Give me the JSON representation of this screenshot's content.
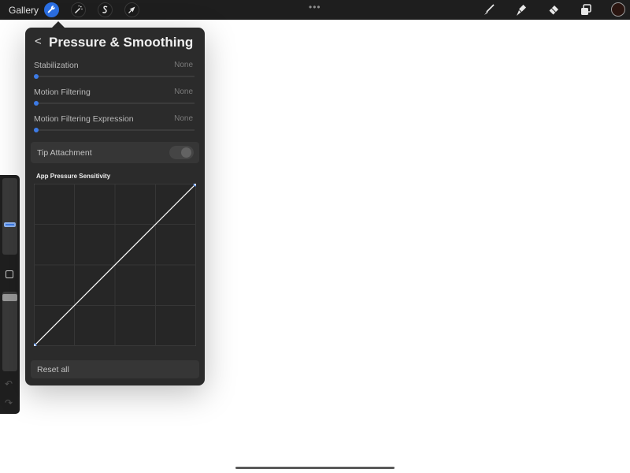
{
  "topbar": {
    "gallery_label": "Gallery",
    "left_tools": [
      "wrench-icon",
      "magic-wand-icon",
      "selection-icon",
      "transform-arrow-icon"
    ],
    "more_label": "•••",
    "right_tools": [
      "brush-icon",
      "smudge-icon",
      "eraser-icon",
      "layers-icon"
    ],
    "current_color": "#2a1510"
  },
  "sidebar": {
    "undo_label": "↶",
    "redo_label": "↷"
  },
  "panel": {
    "back_label": "<",
    "title": "Pressure & Smoothing",
    "settings": [
      {
        "label": "Stabilization",
        "value": "None",
        "slider_level": 0
      },
      {
        "label": "Motion Filtering",
        "value": "None",
        "slider_level": 0
      },
      {
        "label": "Motion Filtering Expression",
        "value": "None",
        "slider_level": 0
      }
    ],
    "tip_attachment": {
      "label": "Tip Attachment",
      "enabled": false
    },
    "curve": {
      "label": "App Pressure Sensitivity",
      "points": [
        [
          0,
          0
        ],
        [
          1,
          1
        ]
      ]
    },
    "reset_label": "Reset all"
  },
  "colors": {
    "accent": "#3d7be6",
    "panel_bg": "#2b2b2b",
    "topbar_bg": "#1e1e1e"
  }
}
